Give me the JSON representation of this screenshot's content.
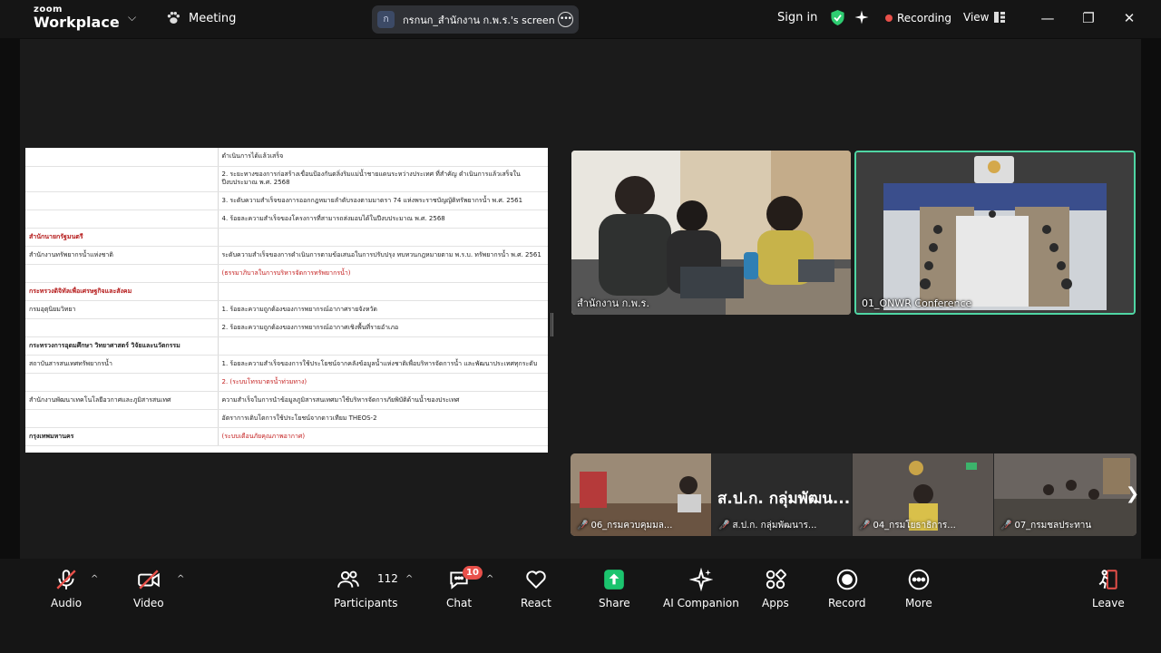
{
  "app": {
    "brand_top": "zoom",
    "brand_bottom": "Workplace",
    "meeting_label": "Meeting",
    "share_avatar_letter": "ก",
    "share_title": "กรกนก_สำนักงาน ก.พ.ร.'s screen",
    "sign_in": "Sign in",
    "recording": "Recording",
    "view": "View"
  },
  "colors": {
    "recording_red": "#e8504a",
    "active_speaker_green": "#4fd6a4",
    "shield_green": "#2ecc71",
    "share_green": "#1bc46e"
  },
  "document": {
    "rows": [
      {
        "left": "",
        "right": "ดำเนินการได้แล้วเสร็จ",
        "left_class": "",
        "right_class": ""
      },
      {
        "left": "",
        "right": "2. ระยะทางของการก่อสร้างเขื่อนป้องกันตลิ่งริมแม่น้ำชายแดนระหว่างประเทศ ที่สำคัญ ดำเนินการแล้วเสร็จในปีงบประมาณ พ.ศ. 2568",
        "left_class": "",
        "right_class": ""
      },
      {
        "left": "",
        "right": "3. ระดับความสำเร็จของการออกกฎหมายลำดับรองตามมาตรา 74 แห่งพระราชบัญญัติทรัพยากรน้ำ พ.ศ. 2561",
        "left_class": "",
        "right_class": ""
      },
      {
        "left": "",
        "right": "4. ร้อยละความสำเร็จของโครงการที่สามารถส่งมอบได้ในปีงบประมาณ พ.ศ. 2568",
        "left_class": "",
        "right_class": ""
      },
      {
        "left": "สำนักนายกรัฐมนตรี",
        "right": "",
        "left_class": "hd red",
        "right_class": ""
      },
      {
        "left": "สำนักงานทรัพยากรน้ำแห่งชาติ",
        "right": "ระดับความสำเร็จของการดำเนินการตามข้อเสนอในการปรับปรุง ทบทวนกฎหมายตาม พ.ร.บ. ทรัพยากรน้ำ พ.ศ. 2561",
        "left_class": "",
        "right_class": ""
      },
      {
        "left": "",
        "right": "(ธรรมาภิบาลในการบริหารจัดการทรัพยากรน้ำ)",
        "left_class": "",
        "right_class": "red"
      },
      {
        "left": "กระทรวงดิจิทัลเพื่อเศรษฐกิจและสังคม",
        "right": "",
        "left_class": "hd red",
        "right_class": ""
      },
      {
        "left": "กรมอุตุนิยมวิทยา",
        "right": "1. ร้อยละความถูกต้องของการพยากรณ์อากาศรายจังหวัด",
        "left_class": "",
        "right_class": ""
      },
      {
        "left": "",
        "right": "2. ร้อยละความถูกต้องของการพยากรณ์อากาศเชิงพื้นที่รายอำเภอ",
        "left_class": "",
        "right_class": ""
      },
      {
        "left": "กระทรวงการอุดมศึกษา วิทยาศาสตร์ วิจัยและนวัตกรรม",
        "right": "",
        "left_class": "hd",
        "right_class": ""
      },
      {
        "left": "สถาบันสารสนเทศทรัพยากรน้ำ",
        "right": "1. ร้อยละความสำเร็จของการใช้ประโยชน์จากคลังข้อมูลน้ำแห่งชาติเพื่อบริหารจัดการน้ำ และพัฒนาประเทศทุกระดับ",
        "left_class": "",
        "right_class": ""
      },
      {
        "left": "",
        "right": "2. (ระบบโทรมาตรน้ำท่วมทาง)",
        "left_class": "",
        "right_class": "red"
      },
      {
        "left": "สำนักงานพัฒนาเทคโนโลยีอวกาศและภูมิสารสนเทศ",
        "right": "ความสำเร็จในการนำข้อมูลภูมิสารสนเทศมาใช้บริหารจัดการภัยพิบัติด้านน้ำของประเทศ",
        "left_class": "",
        "right_class": ""
      },
      {
        "left": "",
        "right": "อัตราการเติบโตการใช้ประโยชน์จากดาวเทียม THEOS-2",
        "left_class": "",
        "right_class": ""
      },
      {
        "left": "กรุงเทพมหานคร",
        "right": "(ระบบเตือนภัยคุณภาพอากาศ)",
        "left_class": "hd",
        "right_class": "red"
      }
    ]
  },
  "tiles": {
    "main_left": "สำนักงาน ก.พ.ร.",
    "main_right": "01_ONWR Conference",
    "strip": [
      {
        "name": "06_กรมควบคุมมลพิษ",
        "display": "06_กรมควบคุมมล...",
        "muted": true,
        "big": ""
      },
      {
        "name": "ส.ป.ก. กลุ่มพัฒนาระบบ",
        "display": "ส.ป.ก. กลุ่มพัฒนาร...",
        "muted": true,
        "big": "ส.ป.ก. กลุ่มพัฒน..."
      },
      {
        "name": "04_กรมโยธาธิการและผังเมือง",
        "display": "04_กรมโยธาธิการ...",
        "muted": true,
        "big": ""
      },
      {
        "name": "07_กรมชลประทาน",
        "display": "07_กรมชลประทาน",
        "muted": true,
        "big": ""
      }
    ]
  },
  "toolbar": {
    "audio": "Audio",
    "video": "Video",
    "participants": "Participants",
    "participant_count": "112",
    "chat": "Chat",
    "chat_badge": "10",
    "react": "React",
    "share": "Share",
    "ai_companion": "AI Companion",
    "apps": "Apps",
    "record": "Record",
    "more": "More",
    "leave": "Leave"
  }
}
